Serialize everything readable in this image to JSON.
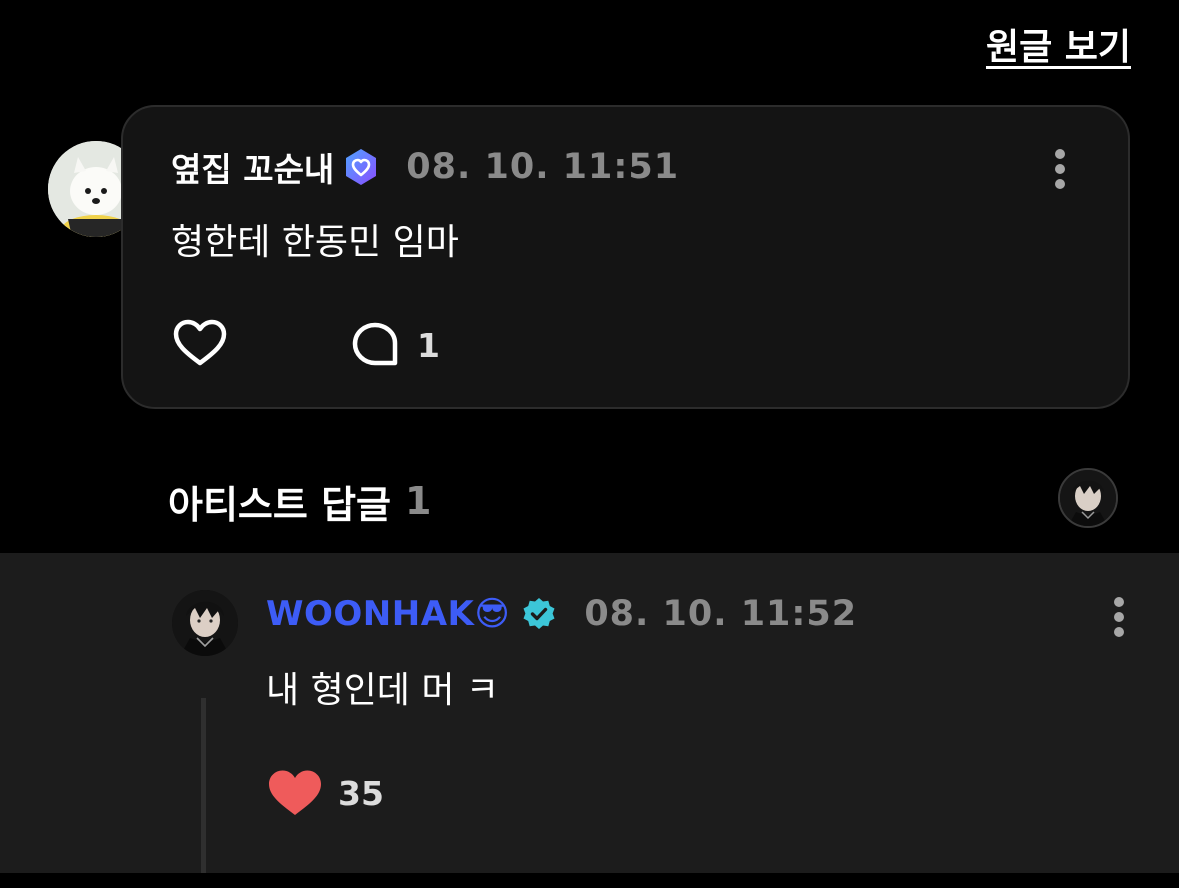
{
  "header": {
    "view_original_label": "원글 보기"
  },
  "fan_comment": {
    "author": "옆집 꼬순내",
    "timestamp": "08. 10. 11:51",
    "text": "형한테 한동민 임마",
    "reply_count": "1",
    "icons": {
      "badge": "verified-heart-badge-icon",
      "more": "more-vertical-icon",
      "like": "heart-outline-icon",
      "reply": "comment-bubble-icon"
    }
  },
  "artist_replies": {
    "title": "아티스트 답글",
    "count": "1"
  },
  "artist_reply": {
    "author": "WOONHAK😎",
    "timestamp": "08. 10. 11:52",
    "text": "내 형인데 머 ㅋ",
    "like_count": "35",
    "icons": {
      "badge": "verified-check-badge-icon",
      "more": "more-vertical-icon",
      "like": "heart-filled-icon"
    }
  },
  "colors": {
    "background": "#000000",
    "card": "#141414",
    "reply_panel": "#1c1c1c",
    "artist_name": "#3d5cf6",
    "timestamp": "#8a8a8a",
    "like_filled": "#ef5b5b",
    "verified_check": "#3cc6d8",
    "verified_heart": "#6c63ff"
  }
}
